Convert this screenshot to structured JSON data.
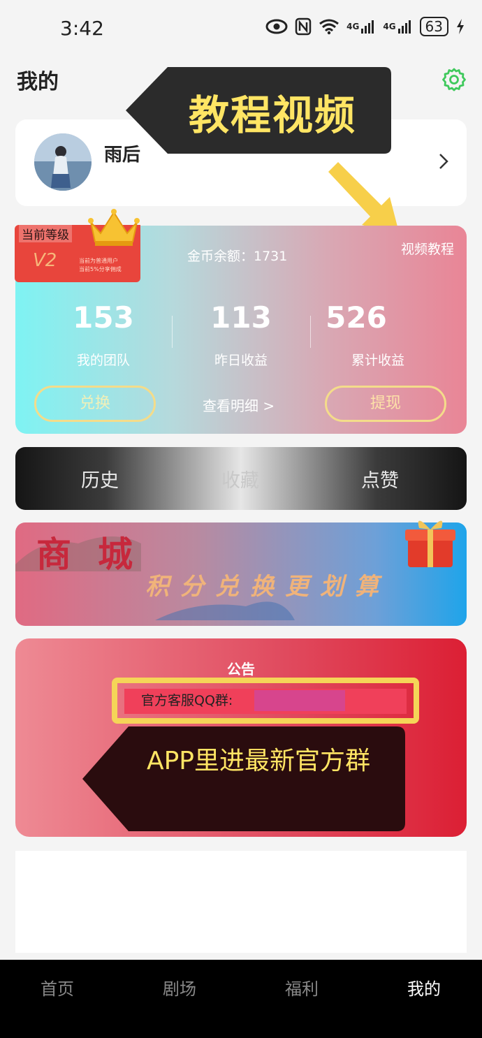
{
  "status_bar": {
    "time": "3:42",
    "signal1": "4G",
    "signal2": "4G",
    "battery": "63"
  },
  "header": {
    "title": "我的"
  },
  "profile": {
    "username": "雨后"
  },
  "callouts": {
    "tutorial": "教程视频",
    "app_group": "APP里进最新官方群"
  },
  "earnings": {
    "level_label": "当前等级",
    "level_value": "V2",
    "level_note_1": "当前为普通用户",
    "level_note_2": "当前5%分享佣成",
    "coin_balance": "金币余额：1731",
    "video_tutorial": "视频教程",
    "stats": [
      {
        "value": "153",
        "label": "我的团队"
      },
      {
        "value": "113",
        "label": "昨日收益"
      },
      {
        "value": "526",
        "label": "累计收益"
      }
    ],
    "exchange_label": "兑换",
    "view_detail": "查看明细 >",
    "withdraw_label": "提现"
  },
  "tabs": [
    "历史",
    "收藏",
    "点赞"
  ],
  "mall_banner": {
    "title": "商城",
    "slogan": "积分兑换更划算"
  },
  "notice": {
    "title": "公告",
    "qq_label": "官方客服QQ群:"
  },
  "bottom_nav": [
    {
      "label": "首页"
    },
    {
      "label": "剧场"
    },
    {
      "label": "福利"
    },
    {
      "label": "我的"
    }
  ],
  "colors": {
    "settings_icon": "#3fc95c",
    "callout_text": "#ffe564",
    "callout_bg": "#2b2b2b",
    "exchange_text": "#f2f0b8",
    "withdraw_text": "#fde2a8"
  },
  "icons": [
    "eye-icon",
    "nfc-icon",
    "wifi-icon",
    "signal-icon",
    "battery-icon",
    "charging-icon",
    "gear-icon",
    "chevron-right-icon",
    "crown-icon",
    "gift-icon"
  ]
}
